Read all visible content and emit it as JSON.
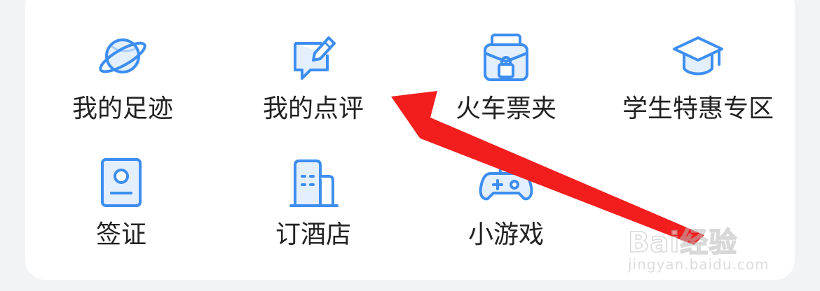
{
  "menu": {
    "items": [
      {
        "label": "我的足迹",
        "icon": "planet-icon"
      },
      {
        "label": "我的点评",
        "icon": "review-edit-icon"
      },
      {
        "label": "火车票夹",
        "icon": "train-ticket-wallet-icon"
      },
      {
        "label": "学生特惠专区",
        "icon": "graduation-cap-icon"
      },
      {
        "label": "签证",
        "icon": "visa-passport-icon"
      },
      {
        "label": "订酒店",
        "icon": "hotel-building-icon"
      },
      {
        "label": "小游戏",
        "icon": "gamepad-icon"
      }
    ]
  },
  "watermark": {
    "logo": "Bai经验",
    "url": "jingyan.baidu.com"
  },
  "colors": {
    "icon_stroke": "#3d8ef0",
    "icon_fill": "#e3effd",
    "label": "#222222",
    "arrow": "#f21d1d",
    "background": "#f2f3f5",
    "card": "#ffffff"
  }
}
